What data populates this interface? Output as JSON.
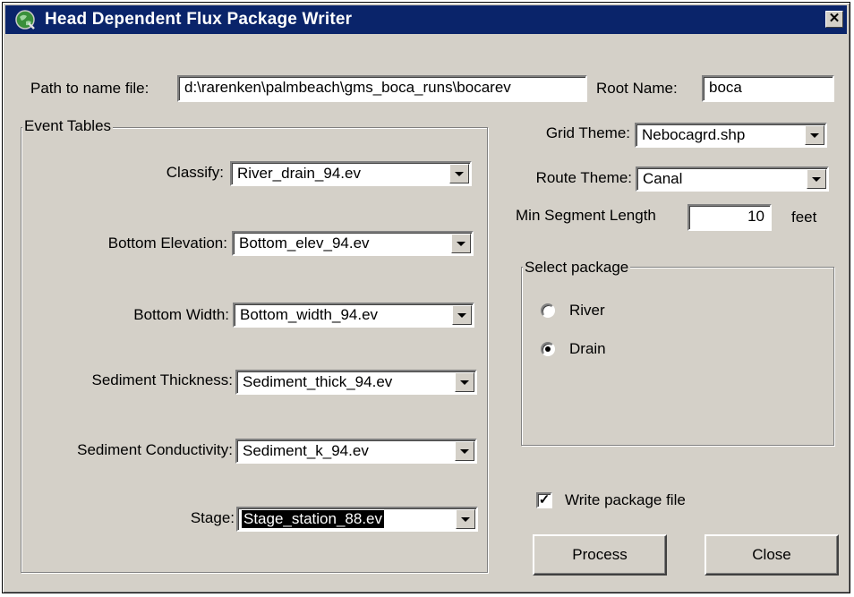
{
  "window": {
    "title": "Head Dependent Flux Package Writer",
    "close_glyph": "✕"
  },
  "path": {
    "label": "Path to name file:",
    "value": "d:\\rarenken\\palmbeach\\gms_boca_runs\\bocarev"
  },
  "root": {
    "label": "Root Name:",
    "value": "boca"
  },
  "event_tables": {
    "title": "Event Tables",
    "rows": [
      {
        "label": "Classify:",
        "value": "River_drain_94.ev"
      },
      {
        "label": "Bottom Elevation:",
        "value": "Bottom_elev_94.ev"
      },
      {
        "label": "Bottom Width:",
        "value": "Bottom_width_94.ev"
      },
      {
        "label": "Sediment Thickness:",
        "value": "Sediment_thick_94.ev"
      },
      {
        "label": "Sediment Conductivity:",
        "value": "Sediment_k_94.ev"
      },
      {
        "label": "Stage:",
        "value": "Stage_station_88.ev"
      }
    ]
  },
  "grid_theme": {
    "label": "Grid Theme:",
    "value": "Nebocagrd.shp"
  },
  "route_theme": {
    "label": "Route Theme:",
    "value": "Canal"
  },
  "min_segment": {
    "label": "Min Segment Length",
    "value": "10",
    "unit": "feet"
  },
  "select_package": {
    "title": "Select package",
    "options": [
      {
        "label": "River",
        "selected": false
      },
      {
        "label": "Drain",
        "selected": true
      }
    ]
  },
  "write_package": {
    "label": "Write package file",
    "checked": true,
    "check_glyph": "✓"
  },
  "buttons": {
    "process": "Process",
    "close": "Close"
  }
}
